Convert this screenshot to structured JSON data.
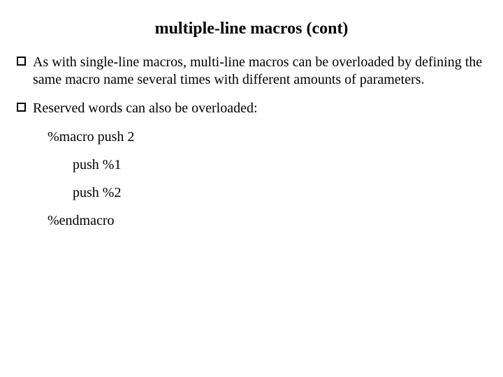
{
  "title": "multiple-line macros (cont)",
  "bullets": [
    "As with single-line macros, multi-line macros can be overloaded by defining the same macro name several times with different amounts of parameters.",
    "Reserved words can also be overloaded:"
  ],
  "code": {
    "line1": "%macro push 2",
    "line2": "push %1",
    "line3": "push %2",
    "line4": "%endmacro"
  }
}
